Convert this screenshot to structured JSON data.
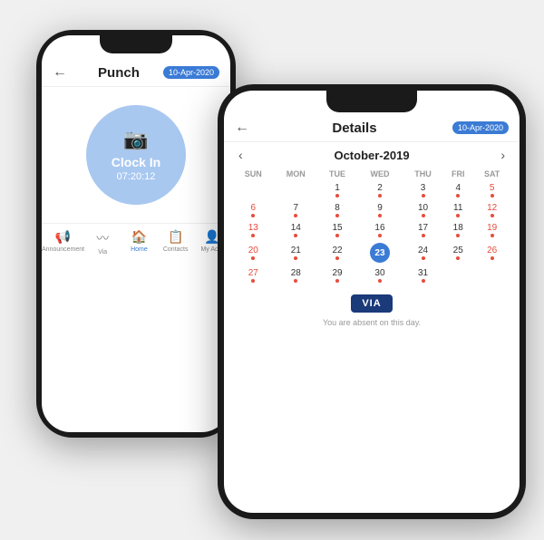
{
  "phone1": {
    "header": {
      "back_icon": "←",
      "title": "Punch",
      "date_badge": "10-Apr-2020"
    },
    "clock_in": {
      "icon": "📷",
      "label": "Clock In",
      "time": "07:20:12"
    },
    "bottom_nav": [
      {
        "icon": "📢",
        "label": "Announcement"
      },
      {
        "icon": "〰",
        "label": "Via"
      },
      {
        "icon": "🏠",
        "label": "Home",
        "active": true
      },
      {
        "icon": "📋",
        "label": "Contacts"
      },
      {
        "icon": "👤",
        "label": "My Ac..."
      }
    ]
  },
  "phone2": {
    "header": {
      "back_icon": "←",
      "title": "Details",
      "date_badge": "10-Apr-2020"
    },
    "calendar": {
      "month": "October-2019",
      "days_header": [
        "SUN",
        "MON",
        "TUE",
        "WED",
        "THU",
        "FRI",
        "SAT"
      ],
      "weeks": [
        [
          null,
          null,
          "1",
          "2",
          "3",
          "4",
          "5"
        ],
        [
          "6",
          "7",
          "8",
          "9",
          "10",
          "11",
          "12"
        ],
        [
          "13",
          "14",
          "15",
          "16",
          "17",
          "18",
          "19"
        ],
        [
          "20",
          "21",
          "22",
          "23",
          "24",
          "25",
          "26"
        ],
        [
          "27",
          "28",
          "29",
          "30",
          "31",
          null,
          null
        ]
      ],
      "today": "23",
      "dots": {
        "red": [
          "1",
          "2",
          "3",
          "4",
          "5",
          "6",
          "7",
          "8",
          "9",
          "10",
          "11",
          "12",
          "13",
          "14",
          "15",
          "16",
          "17",
          "18",
          "19",
          "20",
          "21",
          "22",
          "24",
          "25",
          "26",
          "27",
          "28",
          "29",
          "30",
          "31"
        ],
        "blue": []
      }
    },
    "via_logo": "VIA",
    "absent_text": "You are absent on this day."
  }
}
